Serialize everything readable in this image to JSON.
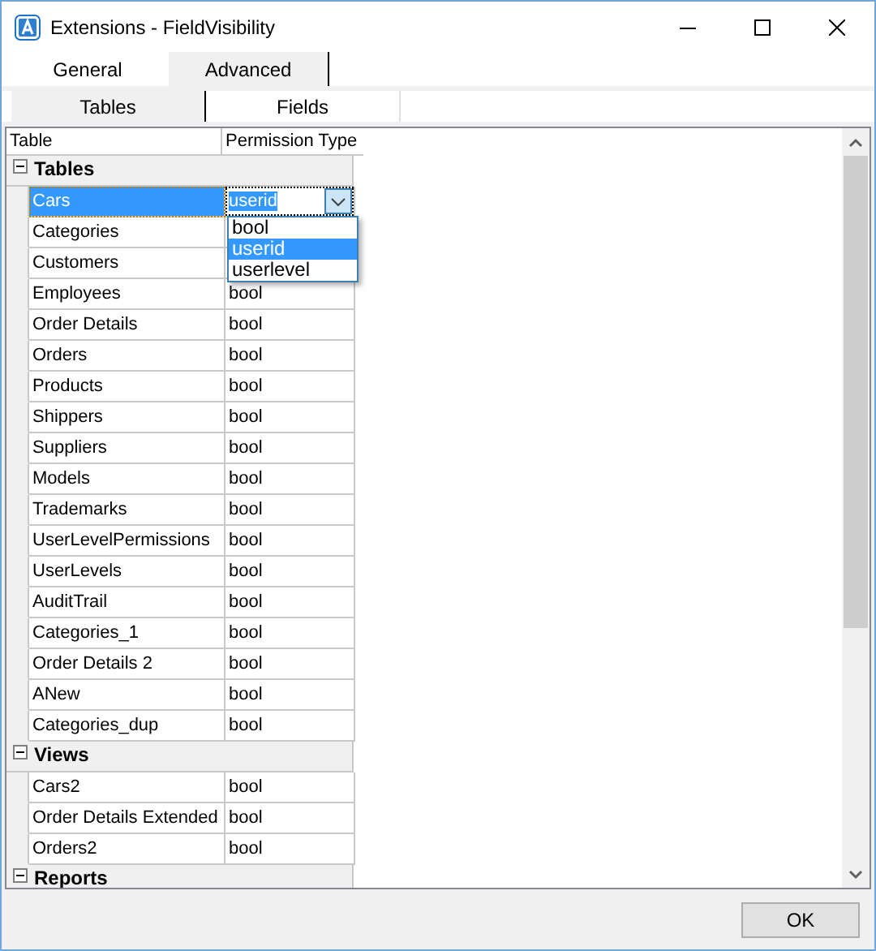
{
  "window": {
    "title": "Extensions - FieldVisibility"
  },
  "tabs": [
    {
      "label": "General",
      "selected": false
    },
    {
      "label": "Advanced",
      "selected": true
    }
  ],
  "subtabs": [
    {
      "label": "Tables",
      "selected": true
    },
    {
      "label": "Fields",
      "selected": false
    }
  ],
  "grid": {
    "columns": [
      "Table",
      "Permission Type"
    ],
    "groups": [
      {
        "name": "Tables",
        "expanded": true,
        "rows": [
          {
            "table": "Cars",
            "permission": "userid",
            "selected": true,
            "editing": true,
            "dropdown": {
              "options": [
                {
                  "label": "bool",
                  "selected": false
                },
                {
                  "label": "userid",
                  "selected": true
                },
                {
                  "label": "userlevel",
                  "selected": false
                }
              ]
            }
          },
          {
            "table": "Categories",
            "selected": false
          },
          {
            "table": "Customers",
            "selected": false
          },
          {
            "table": "Employees",
            "permission": "bool",
            "selected": false
          },
          {
            "table": "Order Details",
            "permission": "bool",
            "selected": false
          },
          {
            "table": "Orders",
            "permission": "bool",
            "selected": false
          },
          {
            "table": "Products",
            "permission": "bool",
            "selected": false
          },
          {
            "table": "Shippers",
            "permission": "bool",
            "selected": false
          },
          {
            "table": "Suppliers",
            "permission": "bool",
            "selected": false
          },
          {
            "table": "Models",
            "permission": "bool",
            "selected": false
          },
          {
            "table": "Trademarks",
            "permission": "bool",
            "selected": false
          },
          {
            "table": "UserLevelPermissions",
            "permission": "bool",
            "selected": false
          },
          {
            "table": "UserLevels",
            "permission": "bool",
            "selected": false
          },
          {
            "table": "AuditTrail",
            "permission": "bool",
            "selected": false
          },
          {
            "table": "Categories_1",
            "permission": "bool",
            "selected": false
          },
          {
            "table": "Order Details 2",
            "permission": "bool",
            "selected": false
          },
          {
            "table": "ANew",
            "permission": "bool",
            "selected": false
          },
          {
            "table": "Categories_dup",
            "permission": "bool",
            "selected": false
          }
        ]
      },
      {
        "name": "Views",
        "expanded": true,
        "rows": [
          {
            "table": "Cars2",
            "permission": "bool",
            "selected": false
          },
          {
            "table": "Order Details Extended",
            "permission": "bool",
            "selected": false
          },
          {
            "table": "Orders2",
            "permission": "bool",
            "selected": false
          }
        ]
      },
      {
        "name": "Reports",
        "expanded": true
      }
    ]
  },
  "buttons": [
    "OK"
  ]
}
